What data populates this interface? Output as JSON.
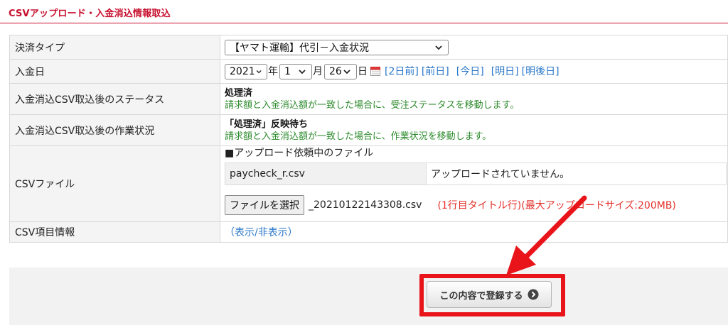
{
  "page": {
    "title": "CSVアップロード・入金消込情報取込"
  },
  "form": {
    "payment_type": {
      "label": "決済タイプ",
      "selected": "【ヤマト運輸】代引－入金状況"
    },
    "deposit_date": {
      "label": "入金日",
      "year": "2021",
      "year_unit": "年",
      "month": "1",
      "month_unit": "月",
      "day": "26",
      "day_unit": "日",
      "links": [
        "[2日前]",
        "[前日]",
        "[今日]",
        "[明日]",
        "[明後日]"
      ]
    },
    "status_after_import": {
      "label": "入金消込CSV取込後のステータス",
      "value": "処理済",
      "note": "請求額と入金消込額が一致した場合に、受注ステータスを移動します。"
    },
    "work_status_after_import": {
      "label": "入金消込CSV取込後の作業状況",
      "value": "「処理済」反映待ち",
      "note": "請求額と入金消込額が一致した場合に、作業状況を移動します。"
    },
    "csv_file": {
      "label": "CSVファイル",
      "pending_heading": "■アップロード依頼中のファイル",
      "pending_file": "paycheck_r.csv",
      "pending_status": "アップロードされていません。",
      "choose_button": "ファイルを選択",
      "chosen_file": "_20210122143308.csv",
      "note": "(1行目タイトル行)(最大アップロードサイズ:200MB)"
    },
    "csv_columns": {
      "label": "CSV項目情報",
      "toggle_link": "（表示/非表示）"
    }
  },
  "actions": {
    "submit_label": "この内容で登録する"
  },
  "colors": {
    "title_red": "#c8102e",
    "link_blue": "#2a77c9",
    "note_green": "#2e8b2e",
    "note_red": "#e4312b",
    "annotation_red": "#e8141a"
  },
  "icons": {
    "calendar": "calendar-icon",
    "dropdown": "chevron-down-icon",
    "submit": "circle-arrow-right-icon",
    "annotation": "red-arrow-annotation"
  }
}
